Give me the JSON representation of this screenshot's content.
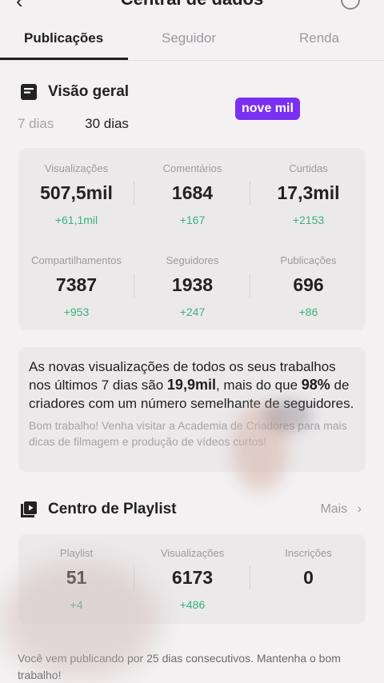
{
  "header": {
    "title": "Central de dados"
  },
  "tabs": [
    {
      "label": "Publicações",
      "active": true
    },
    {
      "label": "Seguidor",
      "active": false
    },
    {
      "label": "Renda",
      "active": false
    }
  ],
  "overview": {
    "title": "Visão geral",
    "periods": [
      "7 dias",
      "30 dias"
    ],
    "selected_period": "30 dias",
    "overlay_label": "nove mil",
    "stats": [
      {
        "label": "Visualizações",
        "value": "507,5mil",
        "delta": "+61,1mil"
      },
      {
        "label": "Comentários",
        "value": "1684",
        "delta": "+167"
      },
      {
        "label": "Curtidas",
        "value": "17,3mil",
        "delta": "+2153"
      },
      {
        "label": "Compartilhamentos",
        "value": "7387",
        "delta": "+953"
      },
      {
        "label": "Seguidores",
        "value": "1938",
        "delta": "+247"
      },
      {
        "label": "Publicações",
        "value": "696",
        "delta": "+86"
      }
    ]
  },
  "insight": {
    "text_1": "As novas visualizações de todos os seus trabalhos nos últimos 7 dias são ",
    "views": "19,9mil",
    "text_2": ", mais do que ",
    "percent": "98%",
    "text_3": " de criadores com um número semelhante de seguidores.",
    "sub": "Bom trabalho! Venha visitar a Academia de Criadores para mais dicas de filmagem e produção de vídeos curtos!"
  },
  "playlist": {
    "title": "Centro de Playlist",
    "more_label": "Mais",
    "stats": [
      {
        "label": "Playlist",
        "value": "51",
        "delta": "+4"
      },
      {
        "label": "Visualizações",
        "value": "6173",
        "delta": "+486"
      },
      {
        "label": "Inscrições",
        "value": "0",
        "delta": ""
      }
    ]
  },
  "footer_note": "Você vem publicando por 25 dias consecutivos. Mantenha o bom trabalho!",
  "colors": {
    "accent_green": "#36b37e",
    "overlay_purple": "#7b2ff2"
  }
}
